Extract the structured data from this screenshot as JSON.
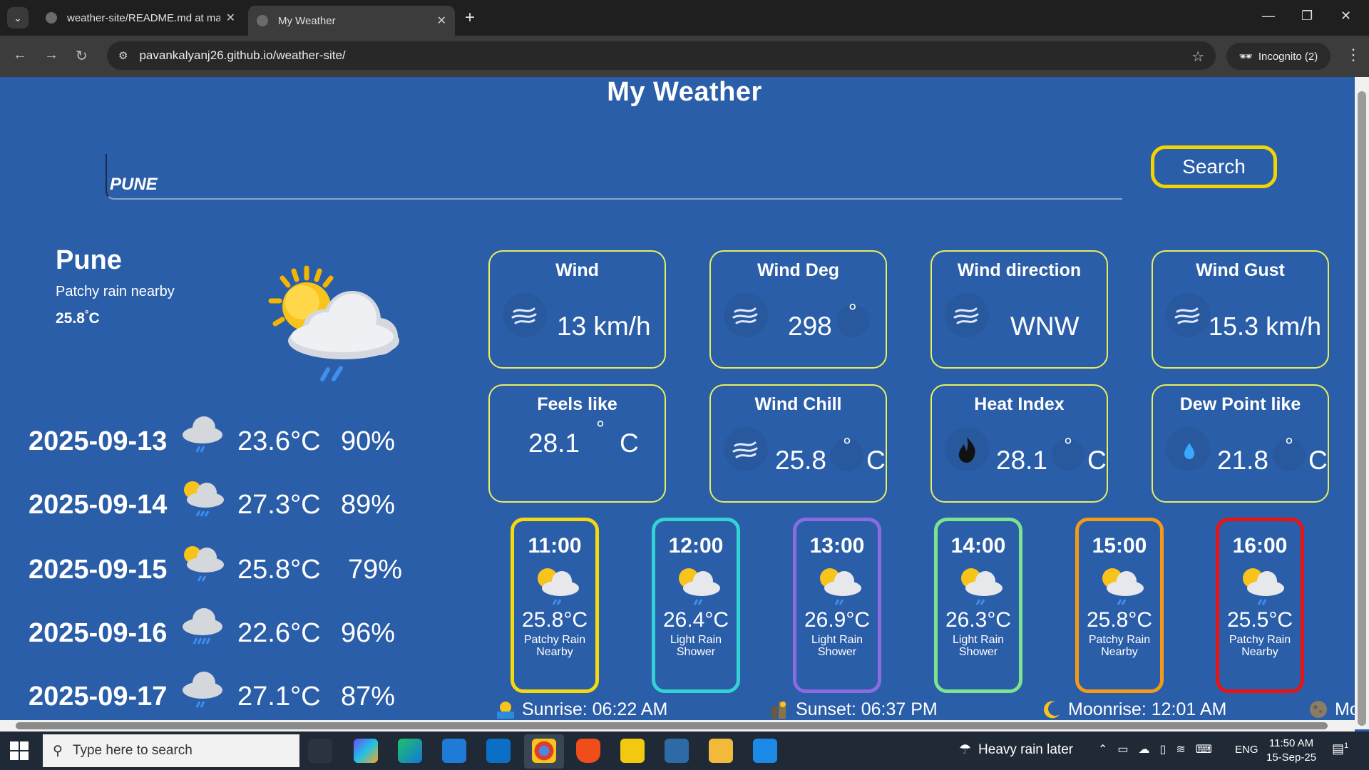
{
  "browser": {
    "tabs": [
      {
        "title": "weather-site/README.md at main",
        "close": "✕"
      },
      {
        "title": "My Weather",
        "close": "✕"
      }
    ],
    "new_tab": "+",
    "url": "pavankalyanj26.github.io/weather-site/",
    "incognito_label": "Incognito (2)",
    "window_controls": {
      "minimize": "—",
      "maximize": "❐",
      "close": "✕"
    }
  },
  "app": {
    "title": "My Weather",
    "search": {
      "value": "PUNE",
      "button_label": "Search"
    }
  },
  "current": {
    "city": "Pune",
    "condition": "Patchy rain nearby",
    "temp": "25.8",
    "unit": "C"
  },
  "forecast": [
    {
      "date": "2025-09-13",
      "temp": "23.6°C",
      "humidity": "90%",
      "icon": "rain-cloud"
    },
    {
      "date": "2025-09-14",
      "temp": "27.3°C",
      "humidity": "89%",
      "icon": "sun-rain-cloud"
    },
    {
      "date": "2025-09-15",
      "temp": "25.8°C",
      "humidity": "79%",
      "icon": "sun-rain-cloud"
    },
    {
      "date": "2025-09-16",
      "temp": "22.6°C",
      "humidity": "96%",
      "icon": "rain-cloud"
    },
    {
      "date": "2025-09-17",
      "temp": "27.1°C",
      "humidity": "87%",
      "icon": "rain-cloud"
    }
  ],
  "cards": {
    "wind": {
      "title": "Wind",
      "value": "13 km/h",
      "icon": "wind-icon"
    },
    "wind_deg": {
      "title": "Wind Deg",
      "value": "298",
      "unit": "°",
      "icon": "wind-icon"
    },
    "wind_dir": {
      "title": "Wind direction",
      "value": "WNW",
      "icon": "wind-icon"
    },
    "wind_gust": {
      "title": "Wind Gust",
      "value": "15.3 km/h",
      "icon": "wind-icon"
    },
    "feels_like": {
      "title": "Feels like",
      "value": "28.1",
      "unit": "C"
    },
    "wind_chill": {
      "title": "Wind Chill",
      "value": "25.8",
      "unit": "C",
      "icon": "wind-icon"
    },
    "heat_index": {
      "title": "Heat Index",
      "value": "28.1",
      "unit": "C",
      "icon": "fire-icon"
    },
    "dew_point": {
      "title": "Dew Point like",
      "value": "21.8",
      "unit": "C",
      "icon": "droplet-icon"
    }
  },
  "hourly": [
    {
      "time": "11:00",
      "temp": "25.8°C",
      "cond1": "Patchy Rain",
      "cond2": "Nearby",
      "color": "#f5d90a"
    },
    {
      "time": "12:00",
      "temp": "26.4°C",
      "cond1": "Light Rain",
      "cond2": "Shower",
      "color": "#34d3d3"
    },
    {
      "time": "13:00",
      "temp": "26.9°C",
      "cond1": "Light Rain",
      "cond2": "Shower",
      "color": "#8a6be0"
    },
    {
      "time": "14:00",
      "temp": "26.3°C",
      "cond1": "Light Rain",
      "cond2": "Shower",
      "color": "#7ce38f"
    },
    {
      "time": "15:00",
      "temp": "25.8°C",
      "cond1": "Patchy Rain",
      "cond2": "Nearby",
      "color": "#f59a16"
    },
    {
      "time": "16:00",
      "temp": "25.5°C",
      "cond1": "Patchy Rain",
      "cond2": "Nearby",
      "color": "#e81414"
    }
  ],
  "astro": {
    "sunrise": "Sunrise: 06:22 AM",
    "sunset": "Sunset: 06:37 PM",
    "moonrise": "Moonrise: 12:01 AM",
    "moonset_partial": "Mo"
  },
  "taskbar": {
    "search_placeholder": "Type here to search",
    "weather": "Heavy rain later",
    "lang": "ENG",
    "time": "11:50 AM",
    "date": "15-Sep-25",
    "notif_count": "1"
  }
}
